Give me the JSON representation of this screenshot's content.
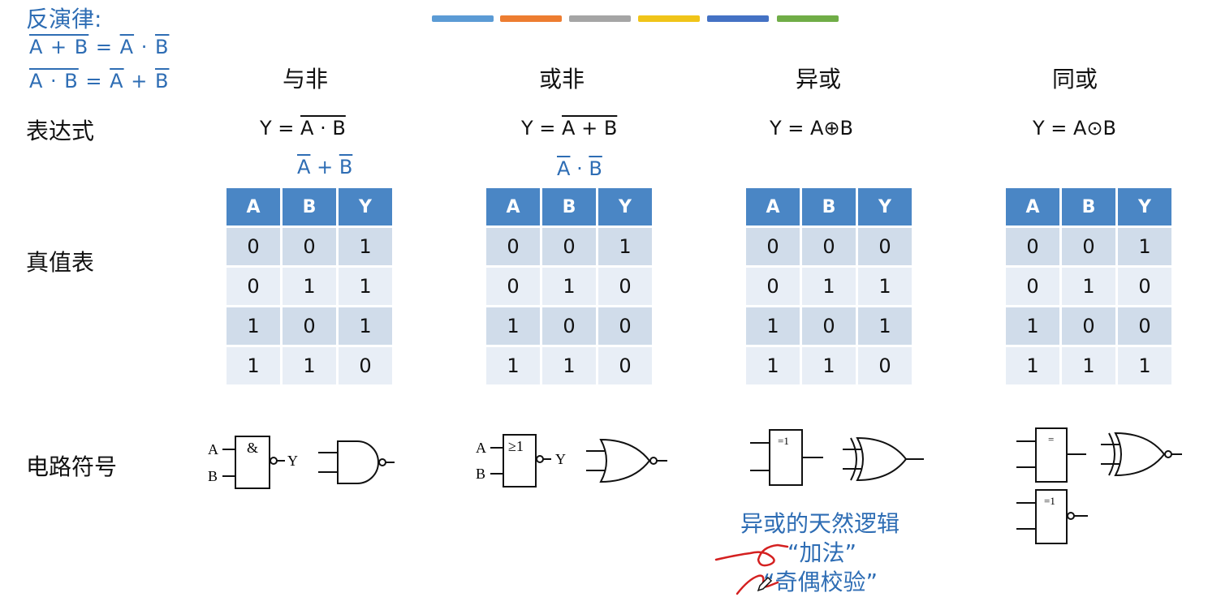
{
  "bars": [
    {
      "color": "#5b9bd5"
    },
    {
      "color": "#ed7d31"
    },
    {
      "color": "#a5a5a5"
    },
    {
      "color": "#f0c419"
    },
    {
      "color": "#4472c4"
    },
    {
      "color": "#70ad47"
    }
  ],
  "law": {
    "title": "反演律:",
    "line1": {
      "lhs": "A + B",
      "eq": "=",
      "a": "A",
      "dot": "·",
      "b": "B"
    },
    "line2": {
      "lhs": "A · B",
      "eq": "=",
      "a": "A",
      "plus": "+",
      "b": "B"
    }
  },
  "rows": {
    "expr": "表达式",
    "truth": "真值表",
    "symbol": "电路符号"
  },
  "gates": [
    {
      "name": "与非",
      "prefix": "Y = ",
      "expr": "A · B",
      "alt": {
        "a": "A",
        "op": "+",
        "b": "B"
      },
      "headers": [
        "A",
        "B",
        "Y"
      ],
      "rows": [
        [
          "0",
          "0",
          "1"
        ],
        [
          "0",
          "1",
          "1"
        ],
        [
          "1",
          "0",
          "1"
        ],
        [
          "1",
          "1",
          "0"
        ]
      ]
    },
    {
      "name": "或非",
      "prefix": "Y = ",
      "expr": "A + B",
      "alt": {
        "a": "A",
        "op": "·",
        "b": "B"
      },
      "headers": [
        "A",
        "B",
        "Y"
      ],
      "rows": [
        [
          "0",
          "0",
          "1"
        ],
        [
          "0",
          "1",
          "0"
        ],
        [
          "1",
          "0",
          "0"
        ],
        [
          "1",
          "1",
          "0"
        ]
      ]
    },
    {
      "name": "异或",
      "prefix": "Y = ",
      "expr": "A⊕B",
      "headers": [
        "A",
        "B",
        "Y"
      ],
      "rows": [
        [
          "0",
          "0",
          "0"
        ],
        [
          "0",
          "1",
          "1"
        ],
        [
          "1",
          "0",
          "1"
        ],
        [
          "1",
          "1",
          "0"
        ]
      ]
    },
    {
      "name": "同或",
      "prefix": "Y = ",
      "expr": "A⊙B",
      "headers": [
        "A",
        "B",
        "Y"
      ],
      "rows": [
        [
          "0",
          "0",
          "1"
        ],
        [
          "0",
          "1",
          "0"
        ],
        [
          "1",
          "0",
          "0"
        ],
        [
          "1",
          "1",
          "1"
        ]
      ]
    }
  ],
  "symbols": {
    "nand_sym": "&",
    "nor_sym": "≥1",
    "xor_sym": "=1",
    "xnor_sym": "=",
    "xnor_sym2": "=1",
    "in_a": "A",
    "in_b": "B",
    "out_y": "Y"
  },
  "note": {
    "line1": "异或的天然逻辑",
    "line2": "“加法”",
    "line3": "“奇偶校验”",
    "ink_color": "#d42020"
  }
}
